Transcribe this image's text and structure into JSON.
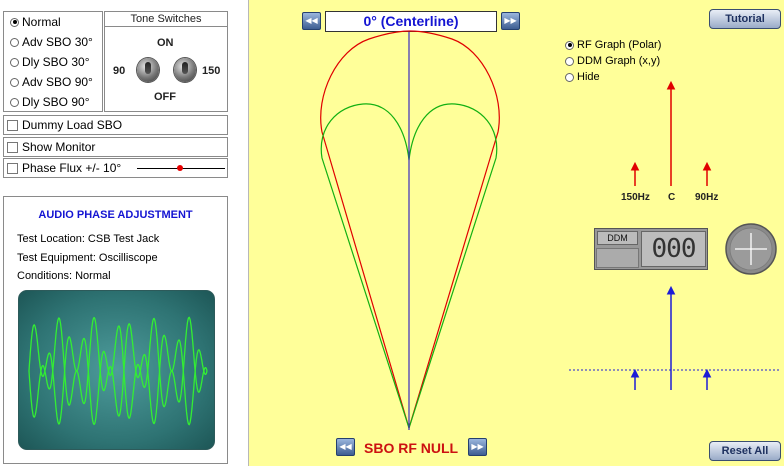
{
  "modes": [
    {
      "label": "Normal",
      "selected": true
    },
    {
      "label": "Adv SBO 30°",
      "selected": false
    },
    {
      "label": "Dly SBO 30°",
      "selected": false
    },
    {
      "label": "Adv SBO 90°",
      "selected": false
    },
    {
      "label": "Dly SBO 90°",
      "selected": false
    }
  ],
  "tone_switches": {
    "title": "Tone Switches",
    "on_label": "ON",
    "off_label": "OFF",
    "left_value": "90",
    "right_value": "150"
  },
  "options": {
    "dummy_load": {
      "label": "Dummy Load SBO",
      "checked": false
    },
    "show_monitor": {
      "label": "Show Monitor",
      "checked": false
    },
    "phase_flux": {
      "label": "Phase Flux +/- 10°",
      "checked": false
    }
  },
  "audio": {
    "title": "AUDIO PHASE ADJUSTMENT",
    "test_location": "Test Location: CSB Test Jack",
    "test_equipment": "Test Equipment: Oscilliscope",
    "conditions": "Conditions: Normal"
  },
  "position": {
    "display": "0° (Centerline)",
    "prev_icon": "rewind-icon",
    "next_icon": "fast-forward-icon"
  },
  "null_label": "SBO RF NULL",
  "buttons": {
    "tutorial": "Tutorial",
    "reset": "Reset All"
  },
  "graph_options": [
    {
      "label": "RF Graph (Polar)",
      "selected": true
    },
    {
      "label": "DDM Graph (x,y)",
      "selected": false
    },
    {
      "label": "Hide",
      "selected": false
    }
  ],
  "freq_labels": {
    "low": "150Hz",
    "center": "C",
    "high": "90Hz"
  },
  "ddm": {
    "label": "DDM",
    "value": "000"
  },
  "colors": {
    "panel_bg": "#ffff99",
    "red_pattern": "#e00000",
    "green_pattern": "#12b012",
    "centerline": "#3b2bbf",
    "scope_trace": "#33ee33",
    "title_blue": "#1414d2"
  }
}
